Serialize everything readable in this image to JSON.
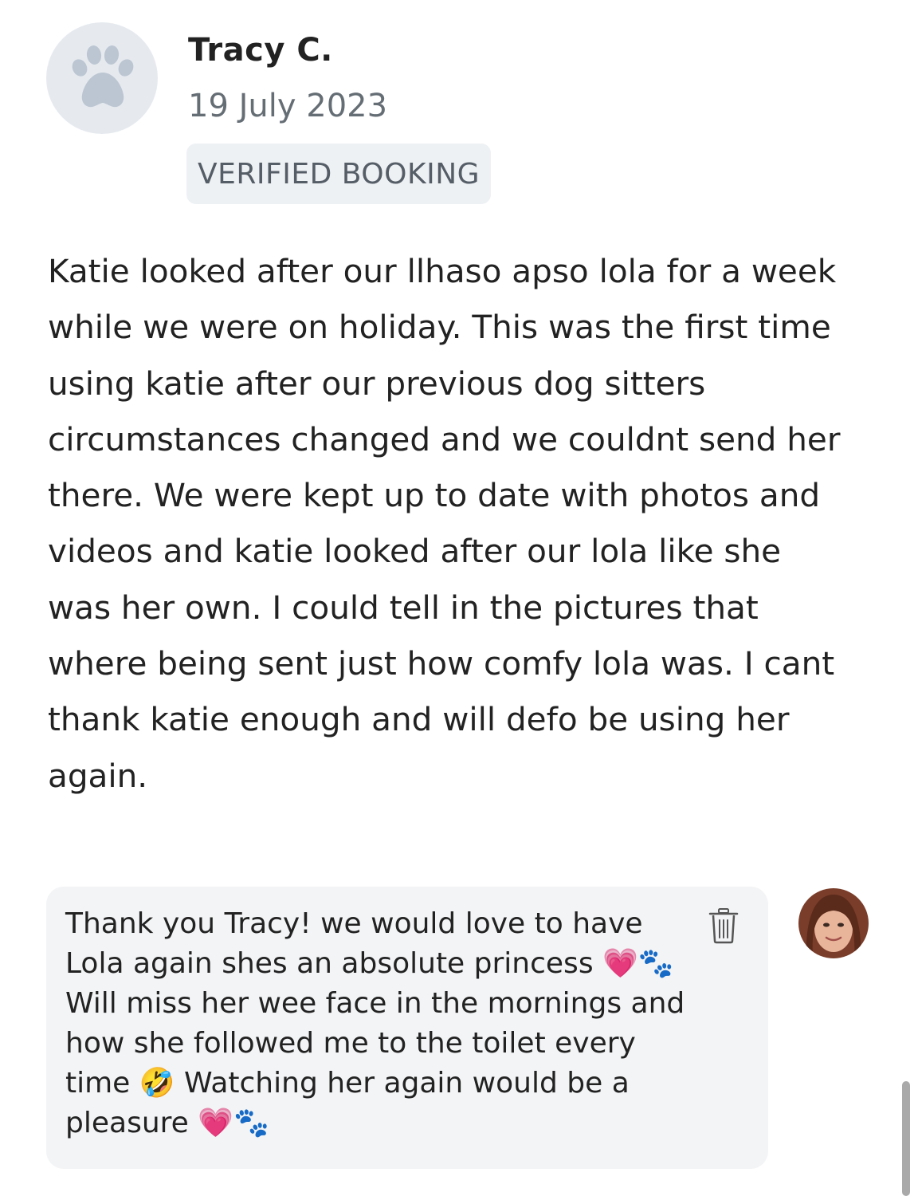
{
  "review": {
    "reviewer_name": "Tracy C.",
    "date": "19 July 2023",
    "badge": "VERIFIED BOOKING",
    "text": "Katie looked after our llhaso apso lola for a week\nwhile we were on holiday. This was the first time\nusing katie after our previous dog sitters\ncircumstances changed and we couldnt send her\nthere. We were kept up to date with photos and\nvideos and katie looked after our lola like she\nwas her own. I could tell in the pictures that\nwhere being sent just how comfy lola was. I cant\nthank katie enough and will defo be using her\nagain."
  },
  "reply": {
    "text": "Thank you Tracy! we would love to have\nLola again shes an absolute princess 💗🐾\nWill miss her wee face in the mornings and\nhow she followed me to the toilet every\ntime 🤣 Watching her again would be a\npleasure 💗🐾"
  },
  "icons": {
    "reviewer_avatar": "paw-icon",
    "delete": "trash-icon",
    "owner_avatar": "profile-photo"
  },
  "colors": {
    "avatar_bg": "#e6eaef",
    "paw": "#bcc6d2",
    "badge_bg": "#eef1f4",
    "reply_bg": "#f3f4f6"
  }
}
